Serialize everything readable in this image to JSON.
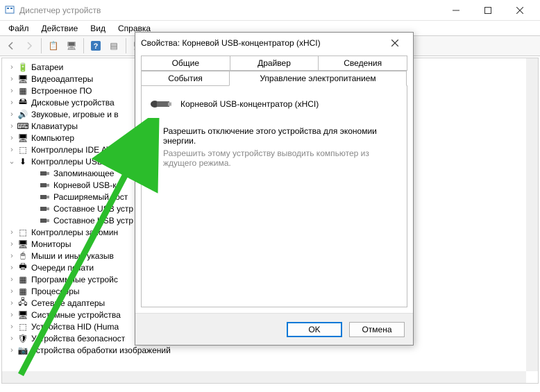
{
  "window": {
    "title": "Диспетчер устройств"
  },
  "menu": {
    "file": "Файл",
    "action": "Действие",
    "view": "Вид",
    "help": "Справка"
  },
  "tree": {
    "items": [
      {
        "label": "Батареи",
        "icon": "🔋"
      },
      {
        "label": "Видеоадаптеры",
        "icon": "🖥"
      },
      {
        "label": "Встроенное ПО",
        "icon": "▦"
      },
      {
        "label": "Дисковые устройства",
        "icon": "🖴"
      },
      {
        "label": "Звуковые, игровые и в",
        "icon": "🔊"
      },
      {
        "label": "Клавиатуры",
        "icon": "⌨"
      },
      {
        "label": "Компьютер",
        "icon": "🖥"
      },
      {
        "label": "Контроллеры IDE ATA/",
        "icon": "⬚"
      },
      {
        "label": "Контроллеры USB",
        "icon": "⬇",
        "expanded": true,
        "children": [
          {
            "label": "Запоминающее"
          },
          {
            "label": "Корневой USB-к"
          },
          {
            "label": "Расширяемый хост"
          },
          {
            "label": "Составное USB устр"
          },
          {
            "label": "Составное USB устр"
          }
        ]
      },
      {
        "label": "Контроллеры запомин",
        "icon": "⬚"
      },
      {
        "label": "Мониторы",
        "icon": "🖥"
      },
      {
        "label": "Мыши и иные указыв",
        "icon": "🖱"
      },
      {
        "label": "Очереди печати",
        "icon": "🖶"
      },
      {
        "label": "Программные устройс",
        "icon": "▦"
      },
      {
        "label": "Процессоры",
        "icon": "▦"
      },
      {
        "label": "Сетевые адаптеры",
        "icon": "🖧"
      },
      {
        "label": "Системные устройства",
        "icon": "🖥"
      },
      {
        "label": "Устройства HID (Huma",
        "icon": "⬚"
      },
      {
        "label": "Устройства безопасност",
        "icon": "🛡"
      },
      {
        "label": "Устройства обработки изображений",
        "icon": "📷"
      }
    ]
  },
  "dialog": {
    "title": "Свойства: Корневой USB-концентратор (xHCI)",
    "tabs": {
      "general": "Общие",
      "driver": "Драйвер",
      "details": "Сведения",
      "events": "События",
      "power": "Управление электропитанием"
    },
    "device_name": "Корневой USB-концентратор (xHCI)",
    "checkbox1": "Разрешить отключение этого устройства для экономии энергии.",
    "checkbox2": "Разрешить этому устройству выводить компьютер из ждущего режима.",
    "ok": "OK",
    "cancel": "Отмена"
  }
}
